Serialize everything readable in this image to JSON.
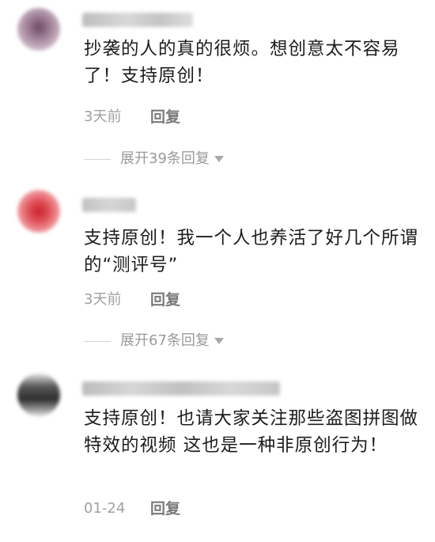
{
  "comments": [
    {
      "text": "抄袭的人的真的很烦。想创意太不容易了！支持原创！",
      "time": "3天前",
      "reply_label": "回复",
      "expand_label": "展开39条回复",
      "avatar_colors": [
        "#7a5a6e",
        "#b49aae",
        "#d8c8d4"
      ]
    },
    {
      "text": "支持原创！我一个人也养活了好几个所谓的“测评号”",
      "time": "3天前",
      "reply_label": "回复",
      "expand_label": "展开67条回复",
      "avatar_colors": [
        "#d13c43",
        "#f07a80",
        "#f8d6d8"
      ]
    },
    {
      "text": "支持原创！也请大家关注那些盗图拼图做特效的视频 这也是一种非原创行为！",
      "time": "01-24",
      "reply_label": "回复",
      "avatar_colors": [
        "#3a3a3a",
        "#8a8a8a",
        "#d0d0d0"
      ]
    }
  ]
}
